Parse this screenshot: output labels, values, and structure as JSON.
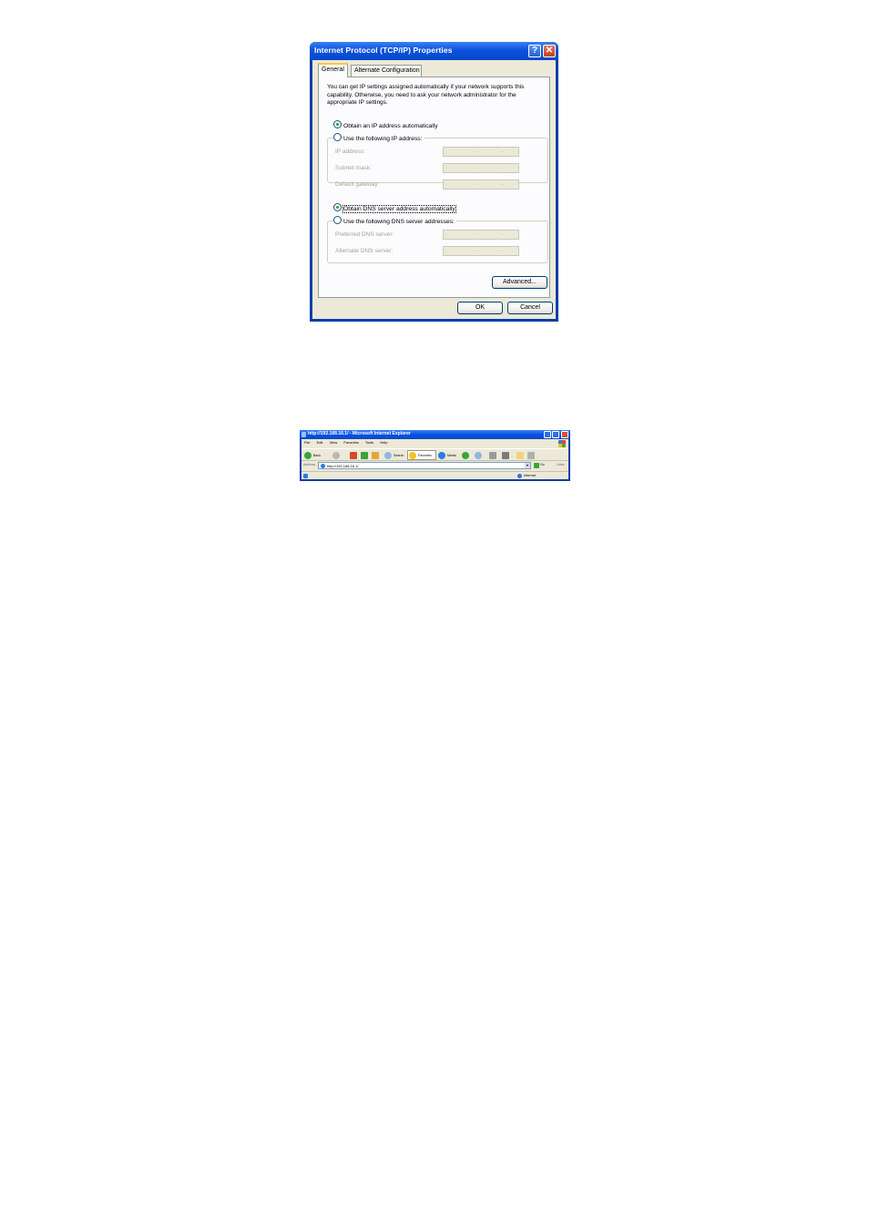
{
  "dialog": {
    "title": "Internet Protocol (TCP/IP) Properties",
    "tabs": [
      {
        "label": "General",
        "active": true
      },
      {
        "label": "Alternate Configuration",
        "active": false
      }
    ],
    "intro_text": "You can get IP settings assigned automatically if your network supports this capability. Otherwise, you need to ask your network administrator for the appropriate IP settings.",
    "ip_mode": {
      "auto_label": "Obtain an IP address automatically",
      "manual_label": "Use the following IP address:",
      "selected": "auto"
    },
    "ip_fields": [
      {
        "label": "IP address:",
        "value": ". . ."
      },
      {
        "label": "Subnet mask:",
        "value": ". . ."
      },
      {
        "label": "Default gateway:",
        "value": ". . ."
      }
    ],
    "dns_mode": {
      "auto_label": "Obtain DNS server address automatically",
      "manual_label": "Use the following DNS server addresses:",
      "selected": "auto"
    },
    "dns_fields": [
      {
        "label": "Preferred DNS server:",
        "value": ". . ."
      },
      {
        "label": "Alternate DNS server:",
        "value": ". . ."
      }
    ],
    "advanced_label": "Advanced...",
    "ok_label": "OK",
    "cancel_label": "Cancel",
    "help_glyph": "?",
    "close_glyph": "✕"
  },
  "browser": {
    "title": "http://192.168.16.1/ - Microsoft Internet Explorer",
    "menu": [
      "File",
      "Edit",
      "View",
      "Favorites",
      "Tools",
      "Help"
    ],
    "toolbar": {
      "back": "Back",
      "search": "Search",
      "favorites": "Favorites",
      "media": "Media"
    },
    "address_label": "Address",
    "address_value": "http://192.168.16.1/",
    "go_label": "Go",
    "links_label": "Links",
    "status_zone": "Internet"
  },
  "colors": {
    "xp_blue": "#0a52e0",
    "dialog_face": "#ece9d8",
    "radio_dot": "#21a121"
  }
}
